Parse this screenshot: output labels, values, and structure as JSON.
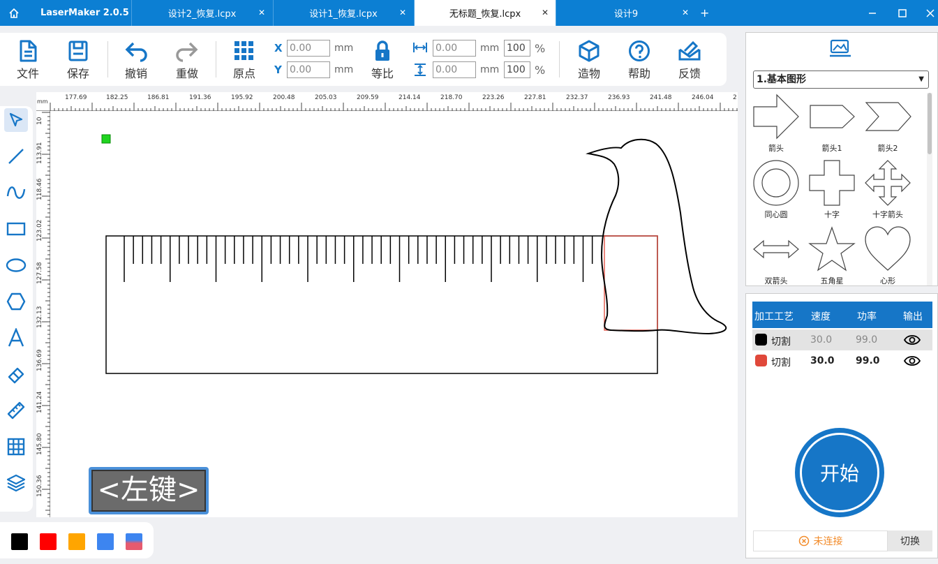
{
  "titlebar": {
    "app_name": "LaserMaker 2.0.5",
    "tabs": [
      {
        "label": "设计2_恢复.lcpx",
        "close": "✕",
        "active": false
      },
      {
        "label": "设计1_恢复.lcpx",
        "close": "✕",
        "active": false
      },
      {
        "label": "无标题_恢复.lcpx",
        "close": "✕",
        "active": true
      },
      {
        "label": "设计9",
        "close": "✕",
        "active": false
      }
    ],
    "add_tab": "+"
  },
  "toolbar": {
    "file": "文件",
    "save": "保存",
    "undo": "撤销",
    "redo": "重做",
    "origin": "原点",
    "proportional": "等比",
    "build": "造物",
    "help": "帮助",
    "feedback": "反馈",
    "x_label": "X",
    "y_label": "Y",
    "x_value": "0.00",
    "y_value": "0.00",
    "width_value": "0.00",
    "height_value": "0.00",
    "width_pct": "100",
    "height_pct": "100",
    "unit_mm": "mm",
    "unit_pct": "%"
  },
  "ruler": {
    "unit": "mm",
    "h_ticks": [
      "177.69",
      "182.25",
      "186.81",
      "191.36",
      "195.92",
      "200.48",
      "205.03",
      "209.59",
      "214.14",
      "218.70",
      "223.26",
      "227.81",
      "232.37",
      "236.93",
      "241.48",
      "246.04",
      "2"
    ],
    "v_ticks": [
      "10",
      "113.91",
      "118.46",
      "123.02",
      "127.58",
      "132.13",
      "136.69",
      "141.24",
      "145.80",
      "150.36"
    ]
  },
  "canvas": {
    "hint": "<左键>"
  },
  "colors": [
    "#000000",
    "#ff0000",
    "#ffa500",
    "#3d85f0"
  ],
  "shape_panel": {
    "category": "1.基本图形",
    "shapes": [
      "箭头",
      "箭头1",
      "箭头2",
      "同心圆",
      "十字",
      "十字箭头",
      "双箭头",
      "五角星",
      "心形"
    ]
  },
  "layers": {
    "headers": [
      "加工工艺",
      "速度",
      "功率",
      "输出"
    ],
    "rows": [
      {
        "color": "#000000",
        "process": "切割",
        "speed": "30.0",
        "power": "99.0"
      },
      {
        "color": "#e0483a",
        "process": "切割",
        "speed": "30.0",
        "power": "99.0"
      }
    ]
  },
  "start_button": "开始",
  "connection": {
    "status": "未连接",
    "switch": "切换"
  }
}
